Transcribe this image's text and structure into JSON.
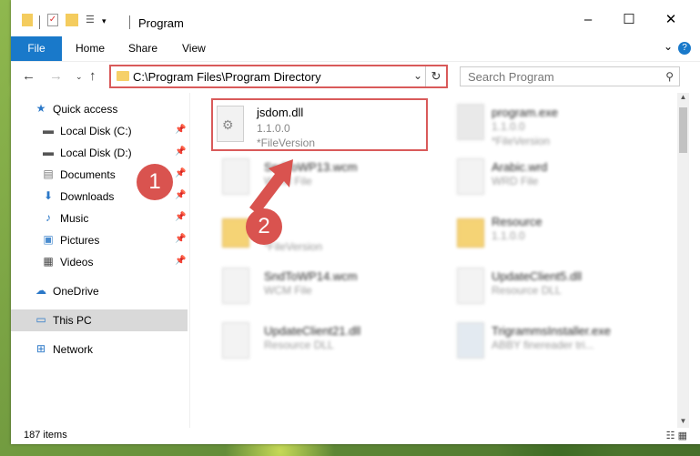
{
  "window": {
    "title": "Program"
  },
  "ribbon": {
    "tabs": [
      "File",
      "Home",
      "Share",
      "View"
    ]
  },
  "address": {
    "path": "C:\\Program Files\\Program Directory"
  },
  "search": {
    "placeholder": "Search Program"
  },
  "nav": {
    "items": [
      {
        "label": "Quick access",
        "icon": "star-icon"
      },
      {
        "label": "Local Disk (C:)",
        "icon": "drive-icon"
      },
      {
        "label": "Local Disk (D:)",
        "icon": "drive-icon"
      },
      {
        "label": "Documents",
        "icon": "documents-icon"
      },
      {
        "label": "Downloads",
        "icon": "downloads-icon"
      },
      {
        "label": "Music",
        "icon": "music-icon"
      },
      {
        "label": "Pictures",
        "icon": "pictures-icon"
      },
      {
        "label": "Videos",
        "icon": "videos-icon"
      },
      {
        "label": "OneDrive",
        "icon": "cloud-icon"
      },
      {
        "label": "This PC",
        "icon": "pc-icon"
      },
      {
        "label": "Network",
        "icon": "network-icon"
      }
    ]
  },
  "files": [
    {
      "name": "jsdom.dll",
      "line2": "1.1.0.0",
      "line3": "*FileVersion"
    },
    {
      "name": "program.exe",
      "line2": "1.1.0.0",
      "line3": "*FileVersion"
    },
    {
      "name": "SndToWP13.wcm",
      "line2": "WCM File",
      "line3": ""
    },
    {
      "name": "Arabic.wrd",
      "line2": "WRD File",
      "line3": ""
    },
    {
      "name": "",
      "line2": "",
      "line3": "*FileVersion"
    },
    {
      "name": "Resource",
      "line2": "1.1.0.0",
      "line3": ""
    },
    {
      "name": "SndToWP14.wcm",
      "line2": "WCM File",
      "line3": ""
    },
    {
      "name": "UpdateClient5.dll",
      "line2": "Resource DLL",
      "line3": ""
    },
    {
      "name": "UpdateClient21.dll",
      "line2": "Resource DLL",
      "line3": ""
    },
    {
      "name": "TrigrammsInstaller.exe",
      "line2": "ABBY finereader tri...",
      "line3": ""
    }
  ],
  "status": {
    "count": "187 items"
  },
  "markers": [
    "1",
    "2"
  ],
  "colors": {
    "accent": "#1979ca",
    "highlight": "#d95a5a",
    "folder": "#f4cc5e"
  }
}
